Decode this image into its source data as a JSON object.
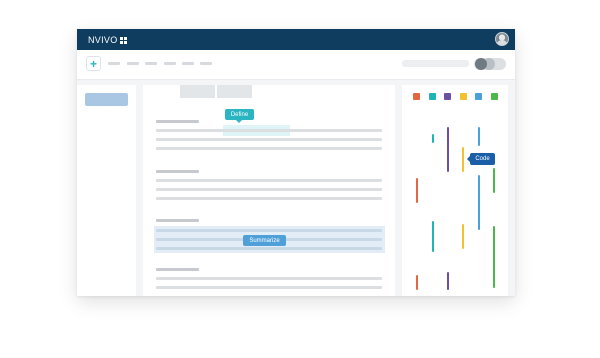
{
  "app": {
    "brand": "NVIVO",
    "colors": {
      "titlebar": "#0e3d5f",
      "teal": "#2bb4c1",
      "blue": "#4f9fd9",
      "navy": "#1b5ea8"
    }
  },
  "toolbar": {
    "add_icon": "plus-icon",
    "add_glyph": "+"
  },
  "document": {
    "define_label": "Define",
    "summarize_label": "Summarize"
  },
  "coding_panel": {
    "code_label": "Code",
    "swatches": [
      "#e4673f",
      "#1fb5b5",
      "#6a4fa3",
      "#f2c12e",
      "#4aa0dc",
      "#4db84a"
    ]
  }
}
